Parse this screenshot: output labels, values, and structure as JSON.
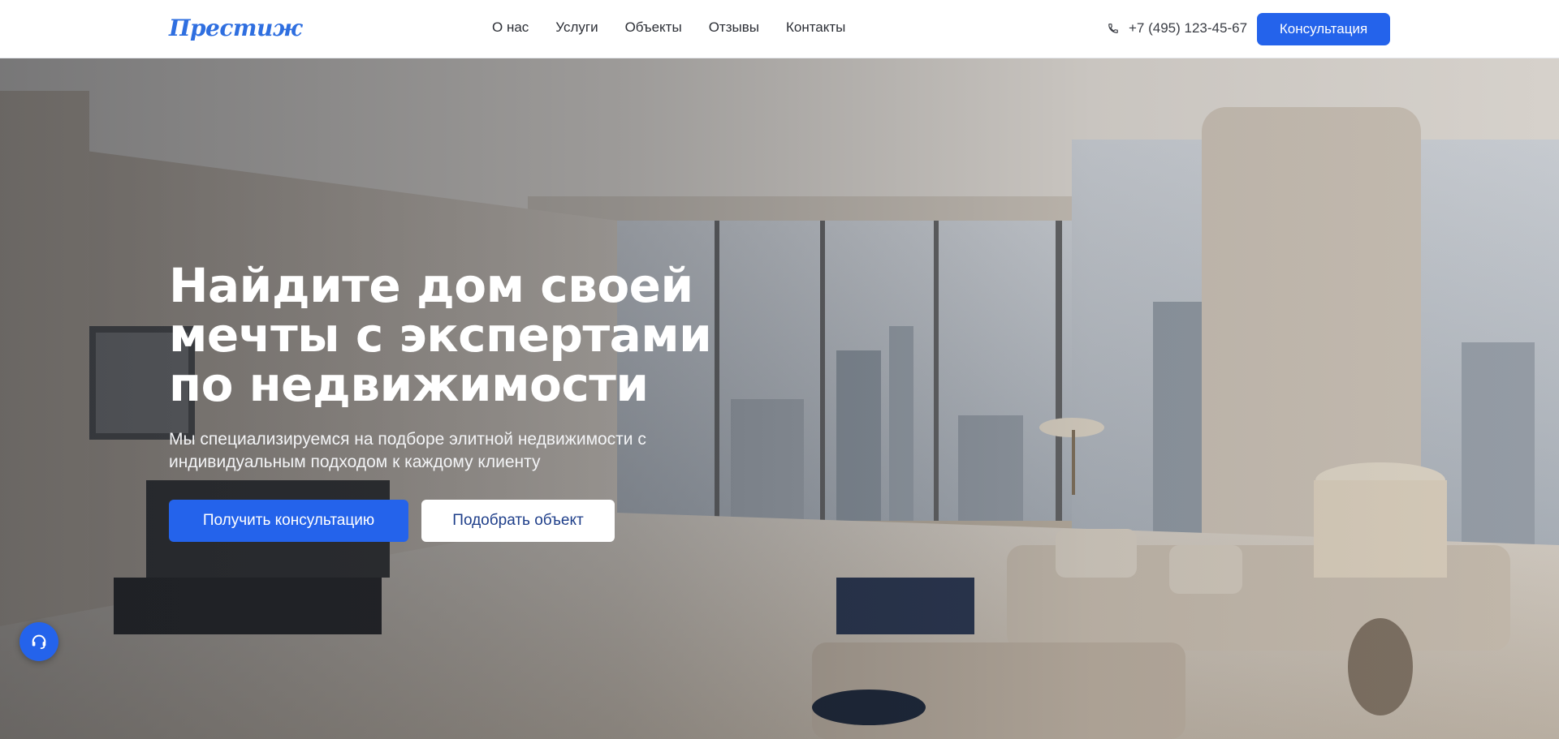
{
  "brand": {
    "logo_text": "Престиж",
    "accent": "#2463eb"
  },
  "nav": {
    "items": [
      {
        "label": "О нас"
      },
      {
        "label": "Услуги"
      },
      {
        "label": "Объекты"
      },
      {
        "label": "Отзывы"
      },
      {
        "label": "Контакты"
      }
    ]
  },
  "header": {
    "phone": "+7 (495) 123-45-67",
    "phone_icon": "phone-icon",
    "cta_label": "Консультация"
  },
  "hero": {
    "title_line1": "Найдите дом своей",
    "title_line2": "мечты с экспертами",
    "title_line3": "по недвижимости",
    "subtitle_line1": "Мы специализируемся на подборе элитной недвижимости с",
    "subtitle_line2": "индивидуальным подходом к каждому клиенту",
    "primary_button": "Получить консультацию",
    "secondary_button": "Подобрать объект"
  },
  "chat_widget": {
    "icon": "headset-icon"
  }
}
